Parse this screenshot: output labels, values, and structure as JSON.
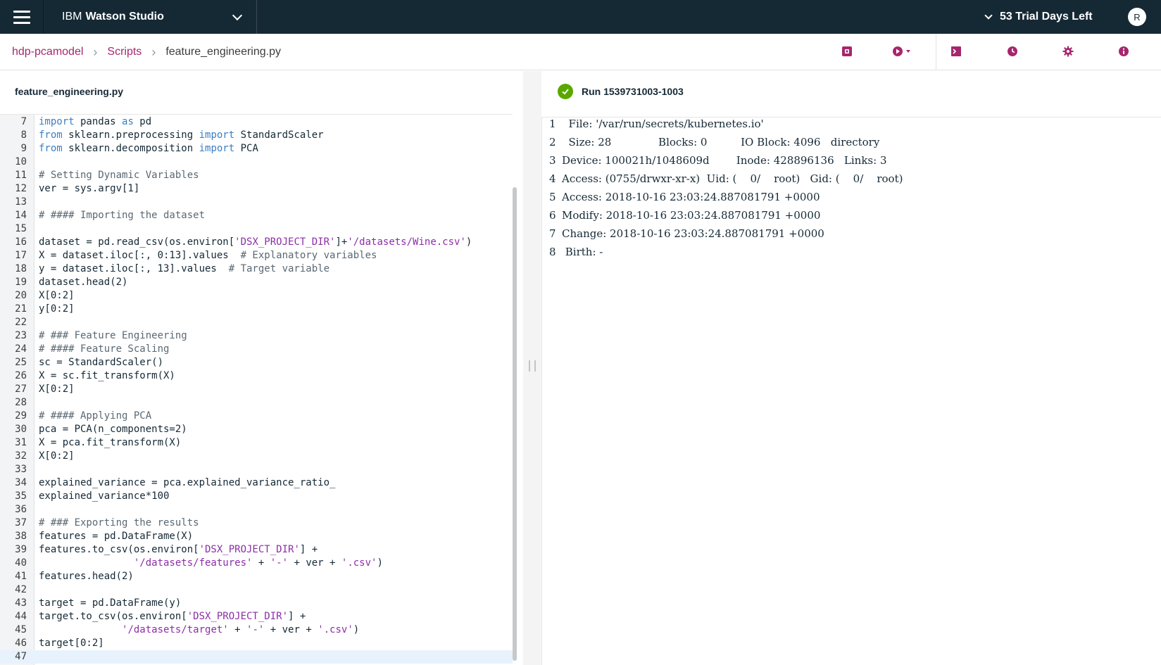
{
  "topbar": {
    "brand_prefix": "IBM",
    "brand_name": "Watson Studio",
    "trial": "53 Trial Days Left",
    "avatar_initial": "R"
  },
  "breadcrumb": {
    "project": "hdp-pcamodel",
    "section": "Scripts",
    "current": "feature_engineering.py"
  },
  "toolbar": {
    "icons": [
      "save-icon",
      "run-icon",
      "terminal-icon",
      "history-icon",
      "settings-icon",
      "info-icon"
    ],
    "accent": "#a6266e"
  },
  "editor": {
    "filename": "feature_engineering.py",
    "lines": [
      {
        "n": "7",
        "tokens": [
          [
            "kw",
            "import"
          ],
          [
            "nm",
            " pandas "
          ],
          [
            "kw",
            "as"
          ],
          [
            "nm",
            " pd"
          ]
        ]
      },
      {
        "n": "8",
        "tokens": [
          [
            "kw",
            "from"
          ],
          [
            "nm",
            " sklearn.preprocessing "
          ],
          [
            "kw",
            "import"
          ],
          [
            "nm",
            " StandardScaler"
          ]
        ]
      },
      {
        "n": "9",
        "tokens": [
          [
            "kw",
            "from"
          ],
          [
            "nm",
            " sklearn.decomposition "
          ],
          [
            "kw",
            "import"
          ],
          [
            "nm",
            " PCA"
          ]
        ]
      },
      {
        "n": "10",
        "tokens": []
      },
      {
        "n": "11",
        "tokens": [
          [
            "cm",
            "# Setting Dynamic Variables"
          ]
        ]
      },
      {
        "n": "12",
        "tokens": [
          [
            "nm",
            "ver = sys.argv[1]"
          ]
        ]
      },
      {
        "n": "13",
        "tokens": []
      },
      {
        "n": "14",
        "tokens": [
          [
            "cm",
            "# #### Importing the dataset"
          ]
        ]
      },
      {
        "n": "15",
        "tokens": []
      },
      {
        "n": "16",
        "tokens": [
          [
            "nm",
            "dataset = pd.read_csv(os.environ["
          ],
          [
            "st",
            "'DSX_PROJECT_DIR'"
          ],
          [
            "nm",
            "]+"
          ],
          [
            "st",
            "'/datasets/Wine.csv'"
          ],
          [
            "nm",
            ")"
          ]
        ]
      },
      {
        "n": "17",
        "tokens": [
          [
            "nm",
            "X = dataset.iloc[:, 0:13].values  "
          ],
          [
            "cm",
            "# Explanatory variables"
          ]
        ]
      },
      {
        "n": "18",
        "tokens": [
          [
            "nm",
            "y = dataset.iloc[:, 13].values  "
          ],
          [
            "cm",
            "# Target variable"
          ]
        ]
      },
      {
        "n": "19",
        "tokens": [
          [
            "nm",
            "dataset.head(2)"
          ]
        ]
      },
      {
        "n": "20",
        "tokens": [
          [
            "nm",
            "X[0:2]"
          ]
        ]
      },
      {
        "n": "21",
        "tokens": [
          [
            "nm",
            "y[0:2]"
          ]
        ]
      },
      {
        "n": "22",
        "tokens": []
      },
      {
        "n": "23",
        "tokens": [
          [
            "cm",
            "# ### Feature Engineering"
          ]
        ]
      },
      {
        "n": "24",
        "tokens": [
          [
            "cm",
            "# #### Feature Scaling"
          ]
        ]
      },
      {
        "n": "25",
        "tokens": [
          [
            "nm",
            "sc = StandardScaler()"
          ]
        ]
      },
      {
        "n": "26",
        "tokens": [
          [
            "nm",
            "X = sc.fit_transform(X)"
          ]
        ]
      },
      {
        "n": "27",
        "tokens": [
          [
            "nm",
            "X[0:2]"
          ]
        ]
      },
      {
        "n": "28",
        "tokens": []
      },
      {
        "n": "29",
        "tokens": [
          [
            "cm",
            "# #### Applying PCA"
          ]
        ]
      },
      {
        "n": "30",
        "tokens": [
          [
            "nm",
            "pca = PCA(n_components=2)"
          ]
        ]
      },
      {
        "n": "31",
        "tokens": [
          [
            "nm",
            "X = pca.fit_transform(X)"
          ]
        ]
      },
      {
        "n": "32",
        "tokens": [
          [
            "nm",
            "X[0:2]"
          ]
        ]
      },
      {
        "n": "33",
        "tokens": []
      },
      {
        "n": "34",
        "tokens": [
          [
            "nm",
            "explained_variance = pca.explained_variance_ratio_"
          ]
        ]
      },
      {
        "n": "35",
        "tokens": [
          [
            "nm",
            "explained_variance*100"
          ]
        ]
      },
      {
        "n": "36",
        "tokens": []
      },
      {
        "n": "37",
        "tokens": [
          [
            "cm",
            "# ### Exporting the results"
          ]
        ]
      },
      {
        "n": "38",
        "tokens": [
          [
            "nm",
            "features = pd.DataFrame(X)"
          ]
        ]
      },
      {
        "n": "39",
        "tokens": [
          [
            "nm",
            "features.to_csv(os.environ["
          ],
          [
            "st",
            "'DSX_PROJECT_DIR'"
          ],
          [
            "nm",
            "] +"
          ]
        ]
      },
      {
        "n": "40",
        "tokens": [
          [
            "nm",
            "                "
          ],
          [
            "st",
            "'/datasets/features'"
          ],
          [
            "nm",
            " + "
          ],
          [
            "st",
            "'-'"
          ],
          [
            "nm",
            " + ver + "
          ],
          [
            "st",
            "'.csv'"
          ],
          [
            "nm",
            ")"
          ]
        ]
      },
      {
        "n": "41",
        "tokens": [
          [
            "nm",
            "features.head(2)"
          ]
        ]
      },
      {
        "n": "42",
        "tokens": []
      },
      {
        "n": "43",
        "tokens": [
          [
            "nm",
            "target = pd.DataFrame(y)"
          ]
        ]
      },
      {
        "n": "44",
        "tokens": [
          [
            "nm",
            "target.to_csv(os.environ["
          ],
          [
            "st",
            "'DSX_PROJECT_DIR'"
          ],
          [
            "nm",
            "] +"
          ]
        ]
      },
      {
        "n": "45",
        "tokens": [
          [
            "nm",
            "              "
          ],
          [
            "st",
            "'/datasets/target'"
          ],
          [
            "nm",
            " + "
          ],
          [
            "st",
            "'-'"
          ],
          [
            "nm",
            " + ver + "
          ],
          [
            "st",
            "'.csv'"
          ],
          [
            "nm",
            ")"
          ]
        ]
      },
      {
        "n": "46",
        "tokens": [
          [
            "nm",
            "target[0:2]"
          ]
        ]
      },
      {
        "n": "47",
        "tokens": []
      }
    ],
    "active_line": "47"
  },
  "run": {
    "title": "Run 1539731003-1003",
    "status_color": "#5aa700",
    "output": [
      {
        "n": "1",
        "text": "  File: '/var/run/secrets/kubernetes.io'"
      },
      {
        "n": "2",
        "text": "  Size: 28              Blocks: 0          IO Block: 4096   directory"
      },
      {
        "n": "3",
        "text": "Device: 100021h/1048609d        Inode: 428896136   Links: 3"
      },
      {
        "n": "4",
        "text": "Access: (0755/drwxr-xr-x)  Uid: (    0/    root)   Gid: (    0/    root)"
      },
      {
        "n": "5",
        "text": "Access: 2018-10-16 23:03:24.887081791 +0000"
      },
      {
        "n": "6",
        "text": "Modify: 2018-10-16 23:03:24.887081791 +0000"
      },
      {
        "n": "7",
        "text": "Change: 2018-10-16 23:03:24.887081791 +0000"
      },
      {
        "n": "8",
        "text": " Birth: -"
      }
    ]
  }
}
